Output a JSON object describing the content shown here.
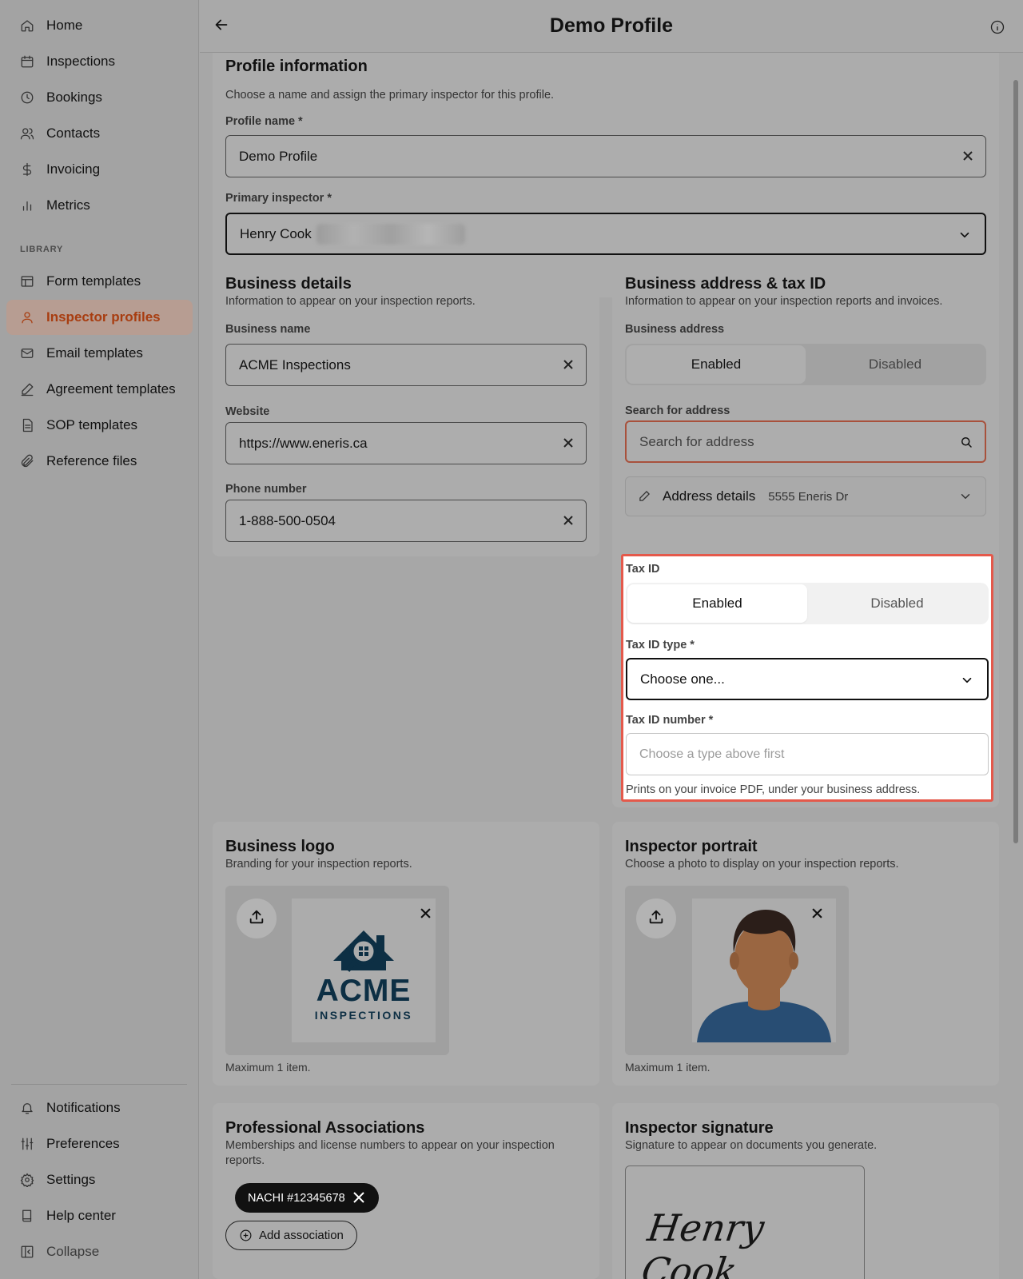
{
  "sidebar": {
    "items": [
      {
        "label": "Home"
      },
      {
        "label": "Inspections"
      },
      {
        "label": "Bookings"
      },
      {
        "label": "Contacts"
      },
      {
        "label": "Invoicing"
      },
      {
        "label": "Metrics"
      }
    ],
    "library_label": "LIBRARY",
    "library_items": [
      {
        "label": "Form templates"
      },
      {
        "label": "Inspector profiles"
      },
      {
        "label": "Email templates"
      },
      {
        "label": "Agreement templates"
      },
      {
        "label": "SOP templates"
      },
      {
        "label": "Reference files"
      }
    ],
    "bottom_items": [
      {
        "label": "Notifications"
      },
      {
        "label": "Preferences"
      },
      {
        "label": "Settings"
      },
      {
        "label": "Help center"
      },
      {
        "label": "Collapse"
      }
    ]
  },
  "header": {
    "title": "Demo Profile"
  },
  "profile_info": {
    "title": "Profile information",
    "subtitle": "Choose a name and assign the primary inspector for this profile.",
    "name_label": "Profile name *",
    "name_value": "Demo Profile",
    "inspector_label": "Primary inspector *",
    "inspector_value": "Henry Cook"
  },
  "business_details": {
    "title": "Business details",
    "subtitle": "Information to appear on your inspection reports.",
    "name_label": "Business name",
    "name_value": "ACME Inspections",
    "website_label": "Website",
    "website_value": "https://www.eneris.ca",
    "phone_label": "Phone number",
    "phone_value": "1-888-500-0504"
  },
  "business_address": {
    "title": "Business address & tax ID",
    "subtitle": "Information to appear on your inspection reports and invoices.",
    "address_label": "Business address",
    "enabled": "Enabled",
    "disabled": "Disabled",
    "search_label": "Search for address",
    "search_placeholder": "Search for address",
    "details_label": "Address details",
    "details_value": "5555 Eneris Dr"
  },
  "tax_id": {
    "label": "Tax ID",
    "enabled": "Enabled",
    "disabled": "Disabled",
    "type_label": "Tax ID type *",
    "type_value": "Choose one...",
    "number_label": "Tax ID number *",
    "number_placeholder": "Choose a type above first",
    "hint": "Prints on your invoice PDF, under your business address."
  },
  "business_logo": {
    "title": "Business logo",
    "subtitle": "Branding for your inspection reports.",
    "logo_text": "ACME",
    "logo_subtext": "INSPECTIONS",
    "max": "Maximum 1 item."
  },
  "inspector_portrait": {
    "title": "Inspector portrait",
    "subtitle": "Choose a photo to display on your inspection reports.",
    "max": "Maximum 1 item."
  },
  "associations": {
    "title": "Professional Associations",
    "subtitle": "Memberships and license numbers to appear on your inspection reports.",
    "chip": "NACHI #12345678",
    "add_label": "Add association"
  },
  "signature": {
    "title": "Inspector signature",
    "subtitle": "Signature to appear on documents you generate.",
    "signature_text": "Henry Cook"
  },
  "colors": {
    "accent": "#a83d10",
    "highlight_border": "#e4594b"
  }
}
